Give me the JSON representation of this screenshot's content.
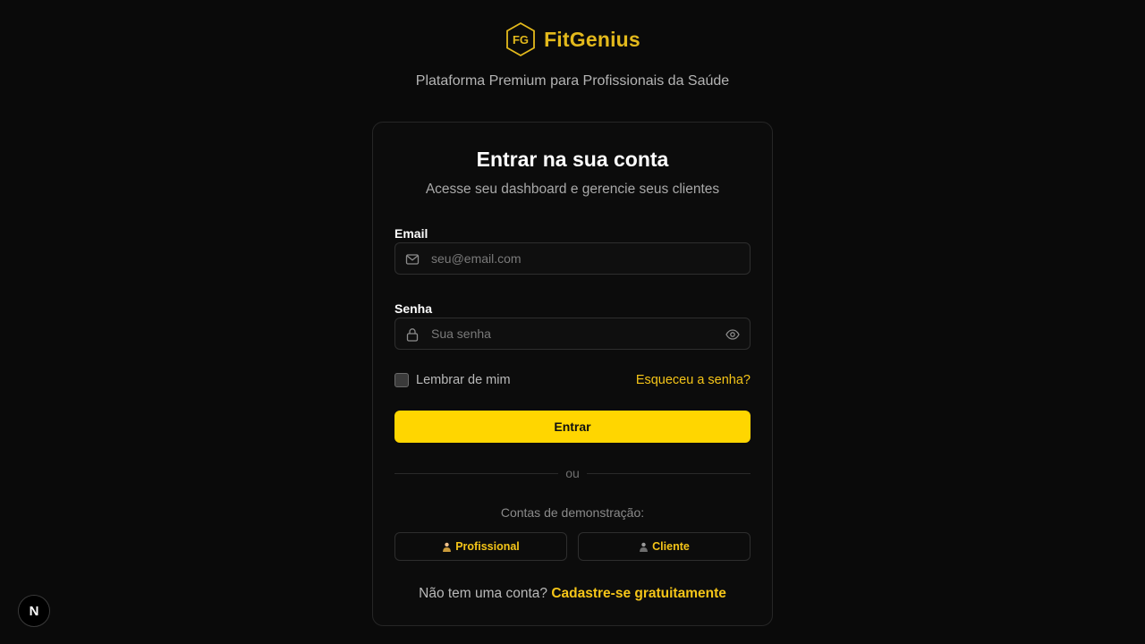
{
  "brand": {
    "logo_text": "FG",
    "name": "FitGenius",
    "tagline": "Plataforma Premium para Profissionais da Saúde",
    "accent_color": "#e3b91c"
  },
  "login": {
    "title": "Entrar na sua conta",
    "subtitle": "Acesse seu dashboard e gerencie seus clientes",
    "email": {
      "label": "Email",
      "placeholder": "seu@email.com",
      "value": "",
      "icon": "mail-icon"
    },
    "password": {
      "label": "Senha",
      "placeholder": "Sua senha",
      "value": "",
      "icon": "lock-icon",
      "toggle_icon": "eye-icon"
    },
    "remember_label": "Lembrar de mim",
    "remember_checked": false,
    "forgot_label": "Esqueceu a senha?",
    "submit_label": "Entrar",
    "submit_color": "#ffd600",
    "divider_label": "ou",
    "demo_title": "Contas de demonstração:",
    "demo_buttons": [
      {
        "label": "Profissional",
        "icon": "professional-person-icon"
      },
      {
        "label": "Cliente",
        "icon": "client-person-icon"
      }
    ],
    "signup_prompt": "Não tem uma conta?",
    "signup_link": "Cadastre-se gratuitamente"
  },
  "dev_badge": {
    "label": "N"
  }
}
